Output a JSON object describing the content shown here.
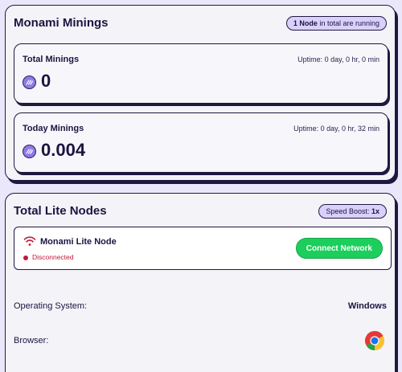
{
  "minings": {
    "title": "Monami Minings",
    "nodes_badge": {
      "count": "1 Node",
      "suffix": " in total are running"
    },
    "total": {
      "title": "Total Minings",
      "uptime": "Uptime: 0 day, 0 hr, 0 min",
      "value": "0"
    },
    "today": {
      "title": "Today Minings",
      "uptime": "Uptime: 0 day, 0 hr, 32 min",
      "value": "0.004"
    },
    "coin_icon": "monami-coin-icon"
  },
  "lite_nodes": {
    "title": "Total Lite Nodes",
    "speed_boost": {
      "label": "Speed Boost: ",
      "value": "1x"
    },
    "node": {
      "name": "Monami Lite Node",
      "status": "Disconnected",
      "status_color": "#c2193a",
      "icon": "wifi-icon",
      "connect_label": "Connect Network"
    },
    "os": {
      "label": "Operating System:",
      "value": "Windows"
    },
    "browser": {
      "label": "Browser:",
      "icon": "chrome-icon"
    }
  },
  "colors": {
    "background": "#ebe7fb",
    "accent": "#8f79e8",
    "connect": "#1ccf5c",
    "border": "#1f1940"
  }
}
